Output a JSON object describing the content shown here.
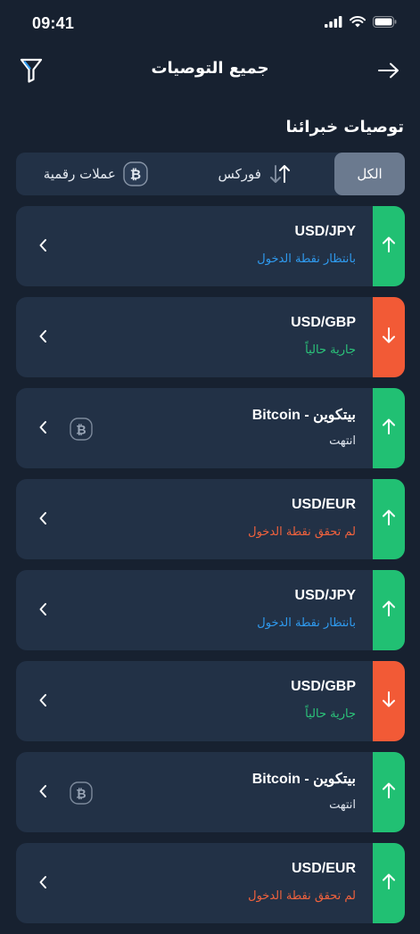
{
  "status_bar": {
    "time": "09:41"
  },
  "header": {
    "title": "جميع التوصيات",
    "filter_icon": "filter-icon",
    "back_icon": "arrow-right-icon"
  },
  "section": {
    "title": "توصيات خبرائنا"
  },
  "filters": {
    "all": "الكل",
    "forex": "فوركس",
    "crypto": "عملات رقمية",
    "selected": "الكل"
  },
  "colors": {
    "background": "#172130",
    "card": "#223146",
    "buy": "#21c073",
    "sell": "#f25a36",
    "waiting": "#2f9bf0",
    "running": "#2bc47a",
    "missed": "#f2623d",
    "selected_segment": "#6b7a8f"
  },
  "recommendations": [
    {
      "pair": "USD/JPY",
      "status": "بانتظار نقطة الدخول",
      "status_type": "waiting",
      "direction": "up",
      "crypto": false
    },
    {
      "pair": "USD/GBP",
      "status": "جارية حالياً",
      "status_type": "running",
      "direction": "down",
      "crypto": false
    },
    {
      "pair": "بيتكوين - Bitcoin",
      "status": "انتهت",
      "status_type": "ended",
      "direction": "up",
      "crypto": true
    },
    {
      "pair": "USD/EUR",
      "status": "لم تحقق نقطة الدخول",
      "status_type": "missed",
      "direction": "up",
      "crypto": false
    },
    {
      "pair": "USD/JPY",
      "status": "بانتظار نقطة الدخول",
      "status_type": "waiting",
      "direction": "up",
      "crypto": false
    },
    {
      "pair": "USD/GBP",
      "status": "جارية حالياً",
      "status_type": "running",
      "direction": "down",
      "crypto": false
    },
    {
      "pair": "بيتكوين - Bitcoin",
      "status": "انتهت",
      "status_type": "ended",
      "direction": "up",
      "crypto": true
    },
    {
      "pair": "USD/EUR",
      "status": "لم تحقق نقطة الدخول",
      "status_type": "missed",
      "direction": "up",
      "crypto": false
    }
  ]
}
